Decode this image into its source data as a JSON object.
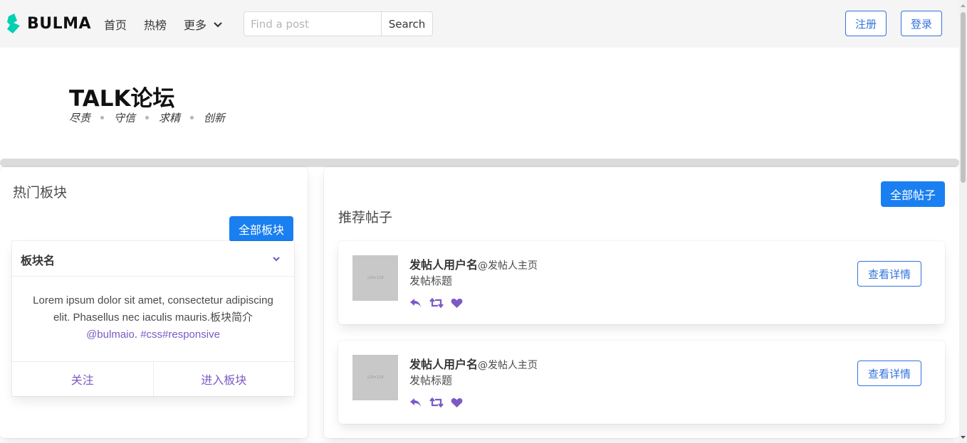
{
  "navbar": {
    "brand": "BULMA",
    "links": [
      "首页",
      "热榜"
    ],
    "more_label": "更多",
    "search_placeholder": "Find a post",
    "search_button": "Search",
    "register_label": "注册",
    "login_label": "登录"
  },
  "hero": {
    "title": "TALK论坛",
    "mottos": [
      "尽责",
      "守信",
      "求精",
      "创新"
    ]
  },
  "left_panel": {
    "title": "热门板块",
    "all_button": "全部板块",
    "card": {
      "header": "板块名",
      "content_text": "Lorem ipsum dolor sit amet, consectetur adipiscing elit. Phasellus nec iaculis mauris.板块简介 ",
      "content_link1": "@bulmaio",
      "content_sep": ". ",
      "content_link2": "#css",
      "content_link3": "#responsive",
      "footer_follow": "关注",
      "footer_enter": "进入板块"
    }
  },
  "right_panel": {
    "title": "推荐帖子",
    "all_button": "全部帖子",
    "posts": [
      {
        "user": "发帖人用户名",
        "home": "@发帖人主页",
        "title": "发帖标题",
        "img_label": "128×128",
        "detail": "查看详情"
      },
      {
        "user": "发帖人用户名",
        "home": "@发帖人主页",
        "title": "发帖标题",
        "img_label": "128×128",
        "detail": "查看详情"
      }
    ]
  },
  "colors": {
    "primary": "#1a7ff0",
    "link": "#3273dc",
    "accent": "#7b5ac6",
    "brand": "#00d1b2"
  }
}
